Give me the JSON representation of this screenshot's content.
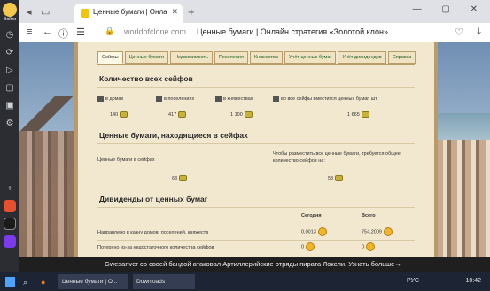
{
  "browser": {
    "profile_label": "Войти",
    "tab_title": "Ценные бумаги | Онла",
    "url": "worldofclone.com",
    "page_title": "Ценные бумаги | Онлайн стратегия «Золотой клон»"
  },
  "content_tabs": [
    {
      "label": "Сейфы"
    },
    {
      "label": "Ценные бумаги"
    },
    {
      "label": "Недвижимость"
    },
    {
      "label": "Поселения"
    },
    {
      "label": "Княжества"
    },
    {
      "label": "Учёт ценных бумаг"
    },
    {
      "label": "Учёт дивидендов"
    },
    {
      "label": "Справка"
    }
  ],
  "safes": {
    "heading": "Количество всех сейфов",
    "categories": [
      {
        "label": "в домах",
        "value": "140"
      },
      {
        "label": "в поселениях",
        "value": "417"
      },
      {
        "label": "в княжествах",
        "value": "1 100"
      },
      {
        "label": "во все сейфы вместится ценных бумаг, шт.",
        "value": "1 665"
      }
    ]
  },
  "securities": {
    "heading": "Ценные бумаги, находящиеся в сейфах",
    "col1_label": "Ценные бумаги в сейфах",
    "col2_label": "Чтобы разместить все ценные бумаги, требуется общее количество сейфов на:",
    "col1_value": "63",
    "col2_value": "53"
  },
  "dividends": {
    "heading": "Дивиденды от ценных бумаг",
    "col_today": "Сегодня",
    "col_total": "Всего",
    "rows": [
      {
        "label": "Направлено в казну домов, поселений, княжеств",
        "today": "0,0013",
        "total": "754,2009"
      },
      {
        "label": "Потеряно из-за недостаточного количества сейфов",
        "today": "0",
        "total": "0"
      }
    ]
  },
  "ticker": "Gwesariver со своей бандой атаковал Артиллерийские отряды пирата Локсли. Узнать больше→",
  "taskbar": {
    "item1": "Ценные бумаги | О...",
    "item2": "Downloads",
    "lang": "РУС",
    "time": "10:42"
  }
}
